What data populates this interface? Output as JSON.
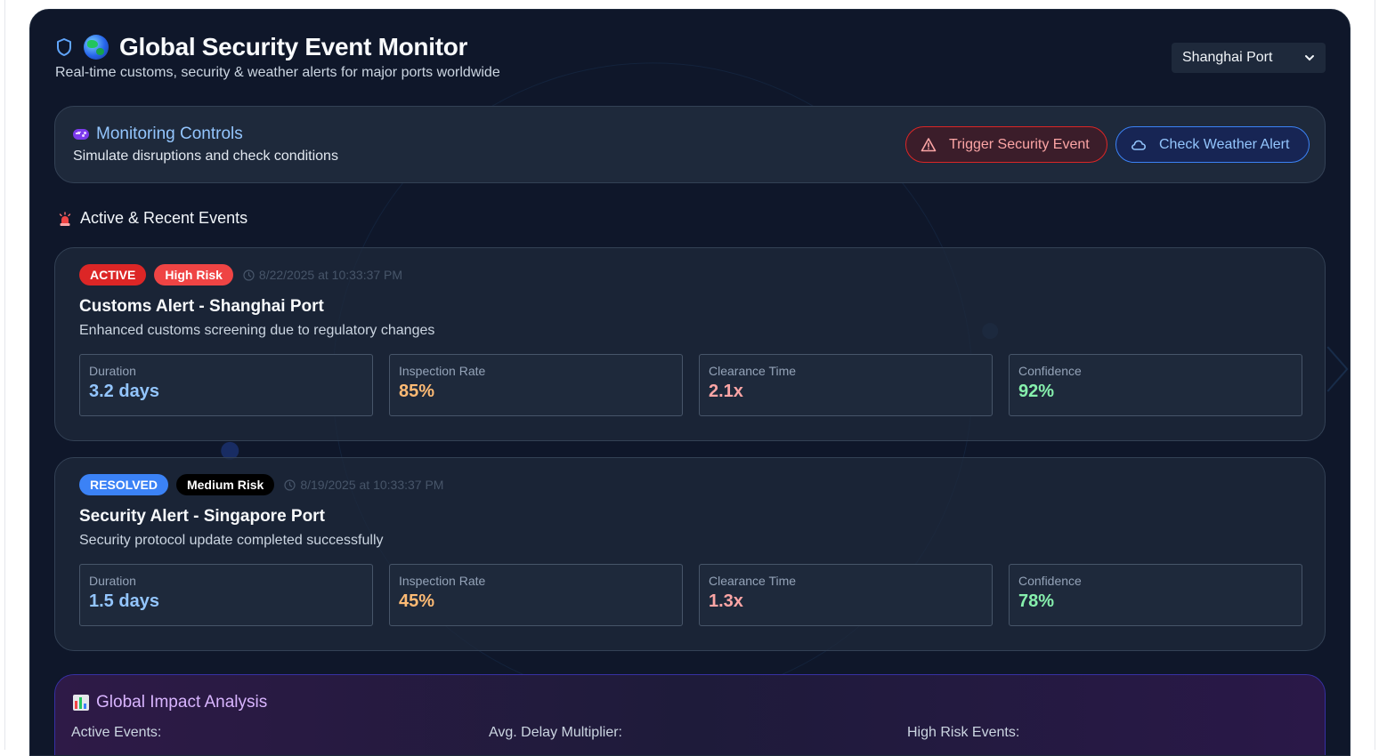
{
  "header": {
    "title": "Global Security Event Monitor",
    "subtitle": "Real-time customs, security & weather alerts for major ports worldwide",
    "port_select": "Shanghai Port"
  },
  "controls": {
    "title": "Monitoring Controls",
    "description": "Simulate disruptions and check conditions",
    "trigger_label": "Trigger Security Event",
    "weather_label": "Check Weather Alert"
  },
  "events_section": {
    "title": "Active & Recent Events"
  },
  "events": [
    {
      "status": "ACTIVE",
      "risk": "High Risk",
      "timestamp": "8/22/2025 at 10:33:37 PM",
      "title": "Customs Alert - Shanghai Port",
      "description": "Enhanced customs screening due to regulatory changes",
      "metrics": [
        {
          "label": "Duration",
          "value": "3.2 days"
        },
        {
          "label": "Inspection Rate",
          "value": "85%"
        },
        {
          "label": "Clearance Time",
          "value": "2.1x"
        },
        {
          "label": "Confidence",
          "value": "92%"
        }
      ]
    },
    {
      "status": "RESOLVED",
      "risk": "Medium Risk",
      "timestamp": "8/19/2025 at 10:33:37 PM",
      "title": "Security Alert - Singapore Port",
      "description": "Security protocol update completed successfully",
      "metrics": [
        {
          "label": "Duration",
          "value": "1.5 days"
        },
        {
          "label": "Inspection Rate",
          "value": "45%"
        },
        {
          "label": "Clearance Time",
          "value": "1.3x"
        },
        {
          "label": "Confidence",
          "value": "78%"
        }
      ]
    }
  ],
  "impact": {
    "title": "Global Impact Analysis",
    "active_events_label": "Active Events:",
    "avg_delay_label": "Avg. Delay Multiplier:",
    "high_risk_label": "High Risk Events:"
  },
  "colors": {
    "panel_bg": "#0f172a",
    "card_bg": "#1e293b",
    "active_badge": "#dc2626",
    "resolved_badge": "#3b82f6",
    "accent_blue": "#93c5fd",
    "accent_purple": "#d8b4fe"
  },
  "icons": {
    "shield": "shield-icon",
    "globe": "globe-icon",
    "gamepad": "gamepad-icon",
    "warning": "warning-triangle-icon",
    "cloud": "cloud-icon",
    "siren": "siren-icon",
    "clock": "clock-icon",
    "chart": "bar-chart-icon"
  }
}
